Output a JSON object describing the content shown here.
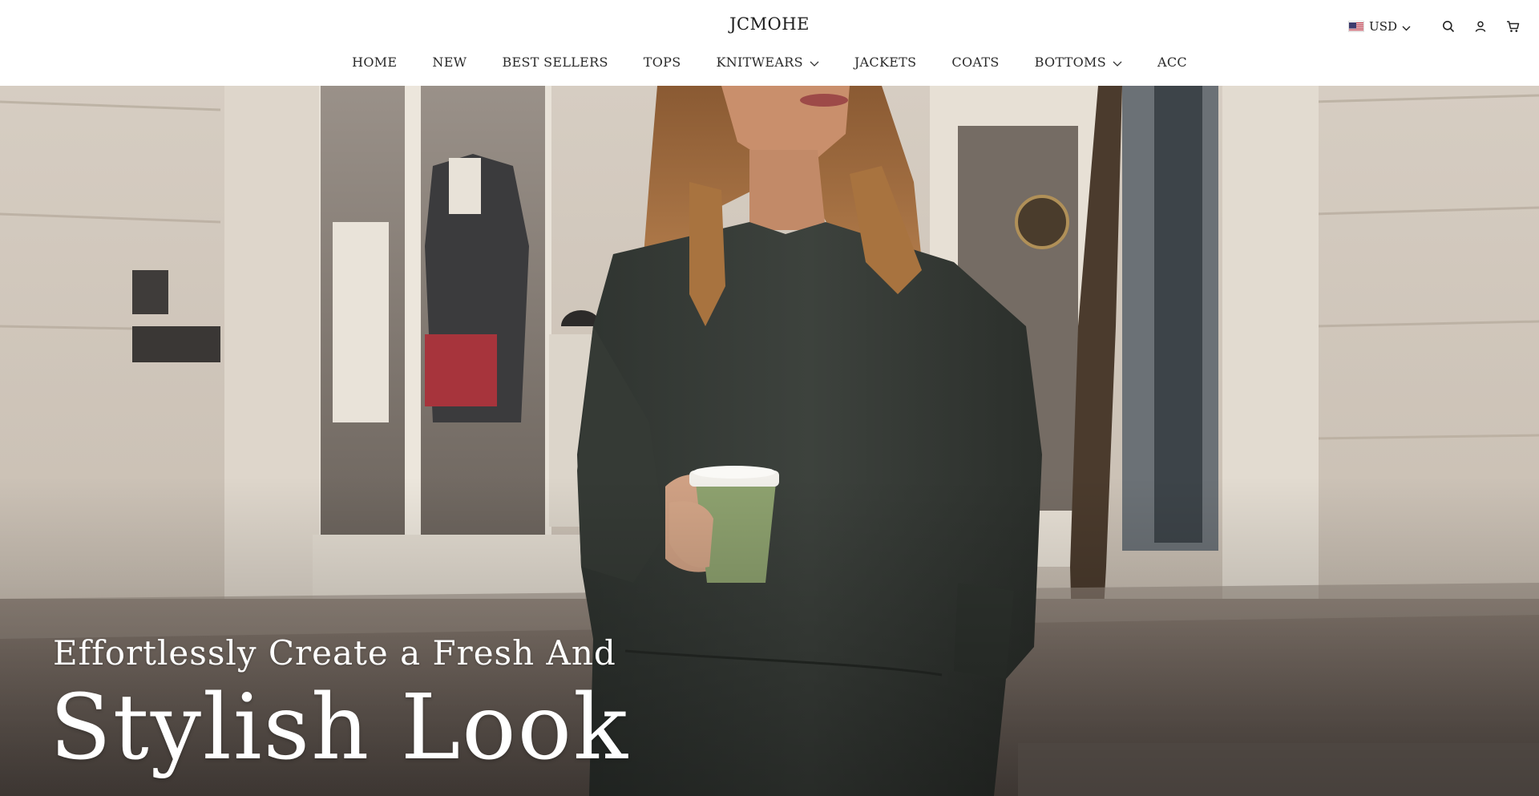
{
  "brand": {
    "name": "JCMOHE"
  },
  "utility": {
    "currency": "USD",
    "icons": [
      "us-flag-icon",
      "chevron-down-icon",
      "search-icon",
      "account-icon",
      "cart-icon"
    ]
  },
  "nav": {
    "items": [
      {
        "label": "HOME",
        "dropdown": false
      },
      {
        "label": "NEW",
        "dropdown": false
      },
      {
        "label": "BEST SELLERS",
        "dropdown": false
      },
      {
        "label": "TOPS",
        "dropdown": false
      },
      {
        "label": "KNITWEARS",
        "dropdown": true
      },
      {
        "label": "JACKETS",
        "dropdown": false
      },
      {
        "label": "COATS",
        "dropdown": false
      },
      {
        "label": "BOTTOMS",
        "dropdown": true
      },
      {
        "label": "ACC",
        "dropdown": false
      }
    ]
  },
  "hero": {
    "subtitle": "Effortlessly Create a Fresh And",
    "title": "Stylish Look"
  },
  "colors": {
    "header_bg": "#ffffff",
    "text": "#1d1d1d",
    "hero_text": "#ffffff",
    "sweater": "#3a3f3a"
  }
}
